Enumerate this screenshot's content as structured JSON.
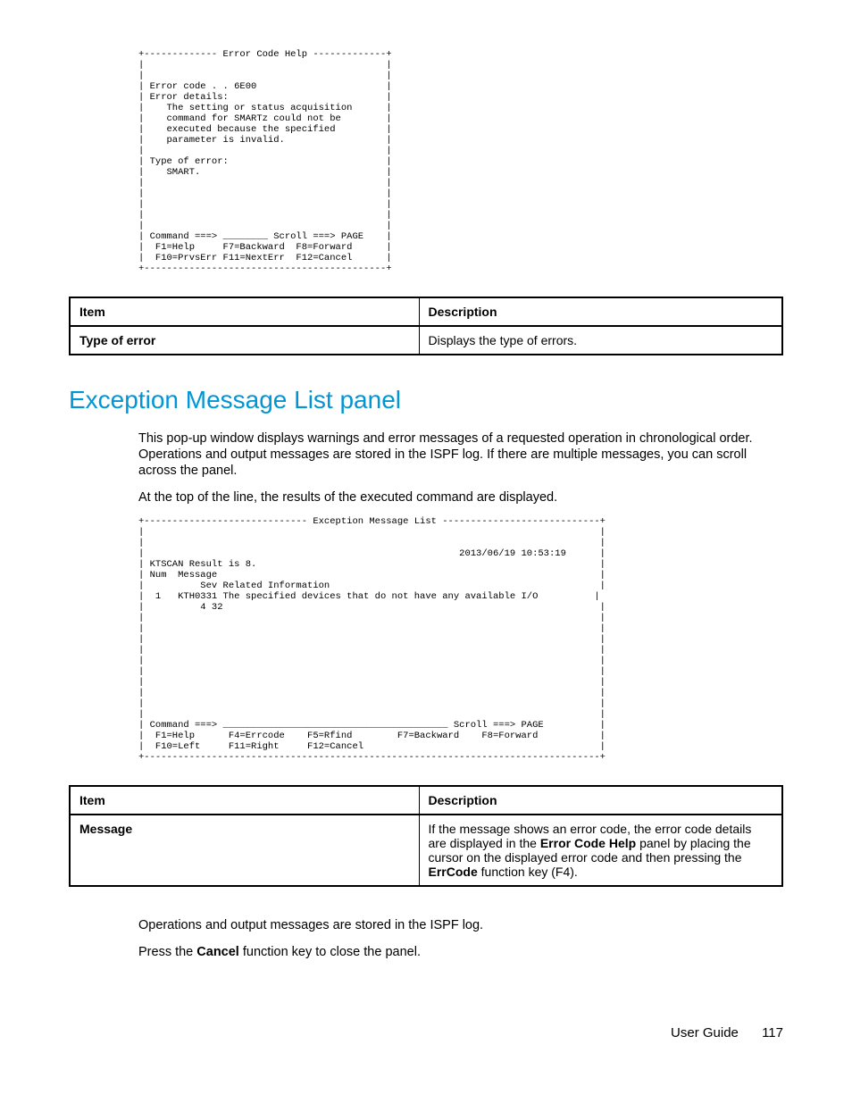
{
  "terminal1": "+------------- Error Code Help -------------+\n|                                           |\n|                                           |\n| Error code . . 6E00                       |\n| Error details:                            |\n|    The setting or status acquisition      |\n|    command for SMARTz could not be        |\n|    executed because the specified         |\n|    parameter is invalid.                  |\n|                                           |\n| Type of error:                            |\n|    SMART.                                 |\n|                                           |\n|                                           |\n|                                           |\n|                                           |\n|                                           |\n| Command ===> ________ Scroll ===> PAGE    |\n|  F1=Help     F7=Backward  F8=Forward      |\n|  F10=PrvsErr F11=NextErr  F12=Cancel      |\n+-------------------------------------------+",
  "table1": {
    "h1": "Item",
    "h2": "Description",
    "r1c1": "Type of error",
    "r1c2": "Displays the type of errors."
  },
  "heading": "Exception Message List panel",
  "para1": "This pop-up window displays warnings and error messages of a requested operation in chronological order. Operations and output messages are stored in the ISPF log. If there are multiple messages, you can scroll across the panel.",
  "para2": "At the top of the line, the results of the executed command are displayed.",
  "terminal2": "+----------------------------- Exception Message List ----------------------------+\n|                                                                                 |\n|                                                                                 |\n|                                                        2013/06/19 10:53:19      |\n| KTSCAN Result is 8.                                                             |\n| Num  Message                                                                    |\n|          Sev Related Information                                                |\n|  1   KTH0331 The specified devices that do not have any available I/O          |\n|          4 32                                                                   |\n|                                                                                 |\n|                                                                                 |\n|                                                                                 |\n|                                                                                 |\n|                                                                                 |\n|                                                                                 |\n|                                                                                 |\n|                                                                                 |\n|                                                                                 |\n|                                                                                 |\n| Command ===> ________________________________________ Scroll ===> PAGE          |\n|  F1=Help      F4=Errcode    F5=Rfind        F7=Backward    F8=Forward           |\n|  F10=Left     F11=Right     F12=Cancel                                          |\n+---------------------------------------------------------------------------------+",
  "table2": {
    "h1": "Item",
    "h2": "Description",
    "r1c1": "Message",
    "r1c2a": "If the message shows an error code, the error code details are displayed in the ",
    "r1c2b": "Error Code Help",
    "r1c2c": " panel by placing the cursor on the displayed error code and then pressing the ",
    "r1c2d": "ErrCode",
    "r1c2e": " function key (F4)."
  },
  "para3": "Operations and output messages are stored in the ISPF log.",
  "para4a": "Press the ",
  "para4b": "Cancel",
  "para4c": " function key to close the panel.",
  "footer_label": "User Guide",
  "footer_page": "117"
}
